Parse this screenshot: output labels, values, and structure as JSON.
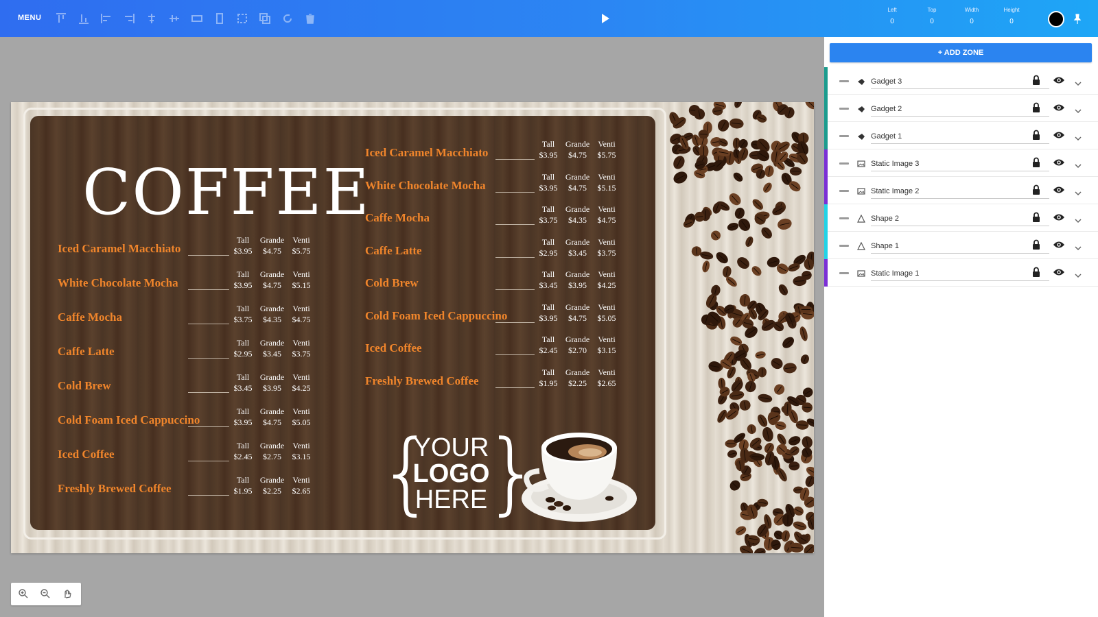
{
  "toolbar": {
    "menu_label": "MENU",
    "fields": [
      {
        "label": "Left",
        "value": "0"
      },
      {
        "label": "Top",
        "value": "0"
      },
      {
        "label": "Width",
        "value": "0"
      },
      {
        "label": "Height",
        "value": "0"
      }
    ],
    "color": "#000000"
  },
  "canvas": {
    "title": "COFFEE",
    "price_headers": [
      "Tall",
      "Grande",
      "Venti"
    ],
    "left_items": [
      {
        "name": "Iced Caramel Macchiato",
        "prices": [
          "$3.95",
          "$4.75",
          "$5.75"
        ]
      },
      {
        "name": "White Chocolate Mocha",
        "prices": [
          "$3.95",
          "$4.75",
          "$5.15"
        ]
      },
      {
        "name": "Caffe Mocha",
        "prices": [
          "$3.75",
          "$4.35",
          "$4.75"
        ]
      },
      {
        "name": "Caffe Latte",
        "prices": [
          "$2.95",
          "$3.45",
          "$3.75"
        ]
      },
      {
        "name": "Cold Brew",
        "prices": [
          "$3.45",
          "$3.95",
          "$4.25"
        ]
      },
      {
        "name": "Cold Foam Iced Cappuccino",
        "prices": [
          "$3.95",
          "$4.75",
          "$5.05"
        ]
      },
      {
        "name": "Iced Coffee",
        "prices": [
          "$2.45",
          "$2.75",
          "$3.15"
        ]
      },
      {
        "name": "Freshly Brewed Coffee",
        "prices": [
          "$1.95",
          "$2.25",
          "$2.65"
        ]
      }
    ],
    "right_items": [
      {
        "name": "Iced Caramel Macchiato",
        "prices": [
          "$3.95",
          "$4.75",
          "$5.75"
        ]
      },
      {
        "name": "White Chocolate Mocha",
        "prices": [
          "$3.95",
          "$4.75",
          "$5.15"
        ]
      },
      {
        "name": "Caffe Mocha",
        "prices": [
          "$3.75",
          "$4.35",
          "$4.75"
        ]
      },
      {
        "name": "Caffe Latte",
        "prices": [
          "$2.95",
          "$3.45",
          "$3.75"
        ]
      },
      {
        "name": "Cold Brew",
        "prices": [
          "$3.45",
          "$3.95",
          "$4.25"
        ]
      },
      {
        "name": "Cold Foam Iced Cappuccino",
        "prices": [
          "$3.95",
          "$4.75",
          "$5.05"
        ]
      },
      {
        "name": "Iced Coffee",
        "prices": [
          "$2.45",
          "$2.70",
          "$3.15"
        ]
      },
      {
        "name": "Freshly Brewed Coffee",
        "prices": [
          "$1.95",
          "$2.25",
          "$2.65"
        ]
      }
    ],
    "logo_lines": [
      "YOUR",
      "LOGO",
      "HERE"
    ]
  },
  "panel": {
    "add_zone_label": "+ ADD ZONE",
    "layers": [
      {
        "name": "Gadget 3",
        "color": "#1b9c8e",
        "type": "gadget"
      },
      {
        "name": "Gadget 2",
        "color": "#1b9c8e",
        "type": "gadget"
      },
      {
        "name": "Gadget 1",
        "color": "#1b9c8e",
        "type": "gadget"
      },
      {
        "name": "Static Image 3",
        "color": "#7b2fd6",
        "type": "image"
      },
      {
        "name": "Static Image 2",
        "color": "#7b2fd6",
        "type": "image"
      },
      {
        "name": "Shape 2",
        "color": "#22d3e6",
        "type": "shape"
      },
      {
        "name": "Shape 1",
        "color": "#22d3e6",
        "type": "shape"
      },
      {
        "name": "Static Image 1",
        "color": "#7b2fd6",
        "type": "image"
      }
    ]
  },
  "icons": {
    "toolbar_tools": [
      "align-top-icon",
      "align-bottom-icon",
      "align-left-icon",
      "align-right-icon",
      "align-center-h-icon",
      "align-center-v-icon",
      "distribute-h-icon",
      "distribute-v-icon",
      "group-icon",
      "duplicate-icon",
      "reset-icon",
      "delete-icon"
    ],
    "play": "play-icon",
    "pin": "pin-icon",
    "zoom": [
      "zoom-in-icon",
      "zoom-out-icon",
      "fit-screen-icon"
    ],
    "layer": [
      "drag-handle-icon",
      "lock-icon",
      "eye-icon",
      "chevron-down-icon"
    ]
  }
}
